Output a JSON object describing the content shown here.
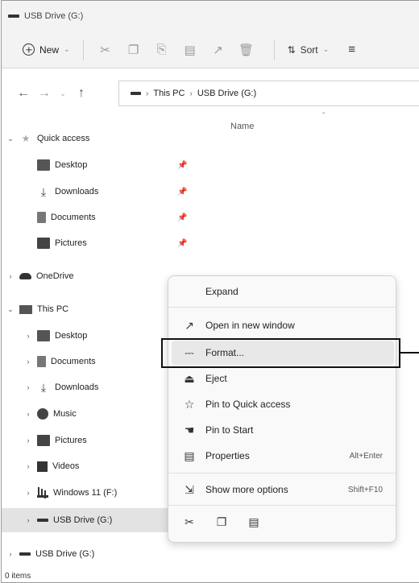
{
  "window": {
    "title": "USB Drive (G:)"
  },
  "toolbar": {
    "new_label": "New",
    "sort_label": "Sort",
    "icons": [
      "cut-icon",
      "copy-icon",
      "paste-icon",
      "rename-icon",
      "share-icon",
      "delete-icon",
      "more-icon"
    ]
  },
  "address": {
    "segments": [
      "This PC",
      "USB Drive (G:)"
    ]
  },
  "navpane": {
    "quick_access": "Quick access",
    "quick_items": [
      {
        "label": "Desktop",
        "icon": "desktop-folder-icon"
      },
      {
        "label": "Downloads",
        "icon": "download-arrow-icon"
      },
      {
        "label": "Documents",
        "icon": "document-folder-icon"
      },
      {
        "label": "Pictures",
        "icon": "pictures-folder-icon"
      }
    ],
    "onedrive": "OneDrive",
    "this_pc": "This PC",
    "pc_items": [
      {
        "label": "Desktop",
        "icon": "desktop-folder-icon"
      },
      {
        "label": "Documents",
        "icon": "document-folder-icon"
      },
      {
        "label": "Downloads",
        "icon": "download-arrow-icon"
      },
      {
        "label": "Music",
        "icon": "music-folder-icon"
      },
      {
        "label": "Pictures",
        "icon": "pictures-folder-icon"
      },
      {
        "label": "Videos",
        "icon": "videos-folder-icon"
      },
      {
        "label": "Windows 11 (F:)",
        "icon": "windows-drive-icon"
      },
      {
        "label": "USB Drive (G:)",
        "icon": "usb-drive-icon"
      }
    ],
    "usb_root": "USB Drive (G:)"
  },
  "content": {
    "name_header": "Name"
  },
  "context_menu": {
    "expand": "Expand",
    "open_new_window": "Open in new window",
    "format": "Format...",
    "eject": "Eject",
    "pin_quick": "Pin to Quick access",
    "pin_start": "Pin to Start",
    "properties": "Properties",
    "properties_shortcut": "Alt+Enter",
    "show_more": "Show more options",
    "show_more_shortcut": "Shift+F10"
  },
  "status": {
    "items": "0 items"
  }
}
